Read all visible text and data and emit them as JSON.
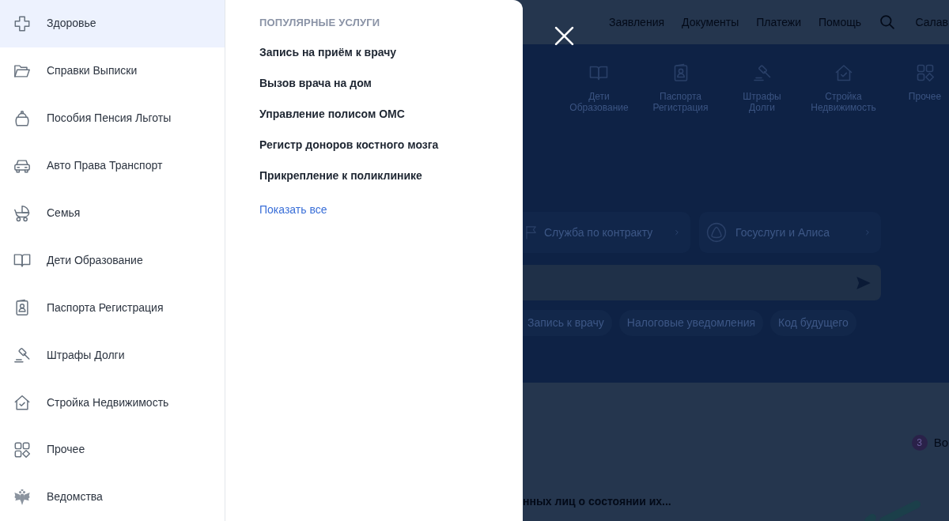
{
  "sidebar": {
    "items": [
      {
        "label": "Здоровье",
        "selected": true
      },
      {
        "label": "Справки Выписки",
        "selected": false
      },
      {
        "label": "Пособия Пенсия Льготы",
        "selected": false
      },
      {
        "label": "Авто Права Транспорт",
        "selected": false
      },
      {
        "label": "Семья",
        "selected": false
      },
      {
        "label": "Дети Образование",
        "selected": false
      },
      {
        "label": "Паспорта Регистрация",
        "selected": false
      },
      {
        "label": "Штрафы Долги",
        "selected": false
      },
      {
        "label": "Стройка Недвижимость",
        "selected": false
      },
      {
        "label": "Прочее",
        "selected": false
      },
      {
        "label": "Ведомства",
        "selected": false
      }
    ]
  },
  "services_panel": {
    "heading": "ПОПУЛЯРНЫЕ УСЛУГИ",
    "links": [
      "Запись на приём к врачу",
      "Вызов врача на дом",
      "Управление полисом ОМС",
      "Регистр доноров костного мозга",
      "Прикрепление к поликлинике"
    ],
    "show_all": "Показать все"
  },
  "background_page": {
    "header": {
      "nav": [
        "Заявления",
        "Документы",
        "Платежи",
        "Помощь"
      ],
      "user_name": "Салав"
    },
    "categories": [
      {
        "label": "Дети\nОбразование"
      },
      {
        "label": "Паспорта\nРегистрация"
      },
      {
        "label": "Штрафы\nДолги"
      },
      {
        "label": "Стройка\nНедвижимость"
      },
      {
        "label": "Прочее"
      }
    ],
    "service_cards": [
      {
        "label": "Служба по контракту"
      },
      {
        "label": "Госуслуги и Алиса"
      }
    ],
    "suggestion_chips": [
      "Запись к врачу",
      "Налоговые уведомления",
      "Код будущего"
    ],
    "notifications": {
      "count": "3",
      "label": "Во"
    },
    "news_title": "нных лиц о состоянии их..."
  }
}
